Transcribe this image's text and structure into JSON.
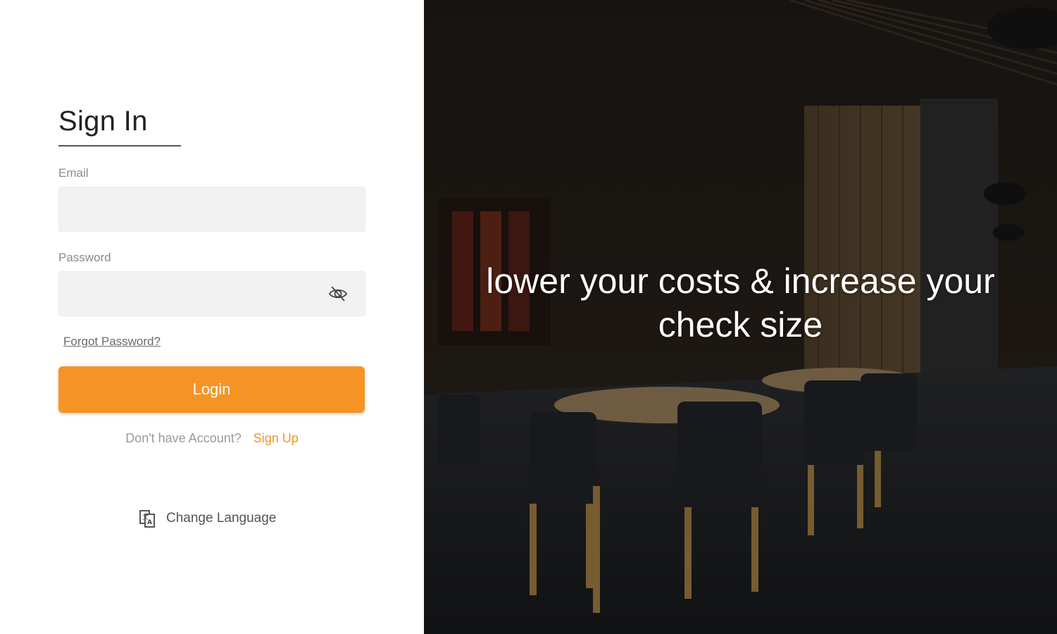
{
  "signin": {
    "title": "Sign In",
    "email_label": "Email",
    "email_value": "",
    "password_label": "Password",
    "password_value": "",
    "forgot_label": "Forgot Password?",
    "login_label": "Login",
    "no_account_prompt": "Don't have Account?",
    "signup_label": "Sign Up",
    "change_language_label": "Change Language"
  },
  "hero": {
    "tagline": "lower your costs & increase your check size"
  },
  "colors": {
    "accent": "#f59425",
    "input_bg": "#f2f2f2"
  },
  "icons": {
    "password_toggle": "eye-slash-icon",
    "language": "translate-icon"
  }
}
